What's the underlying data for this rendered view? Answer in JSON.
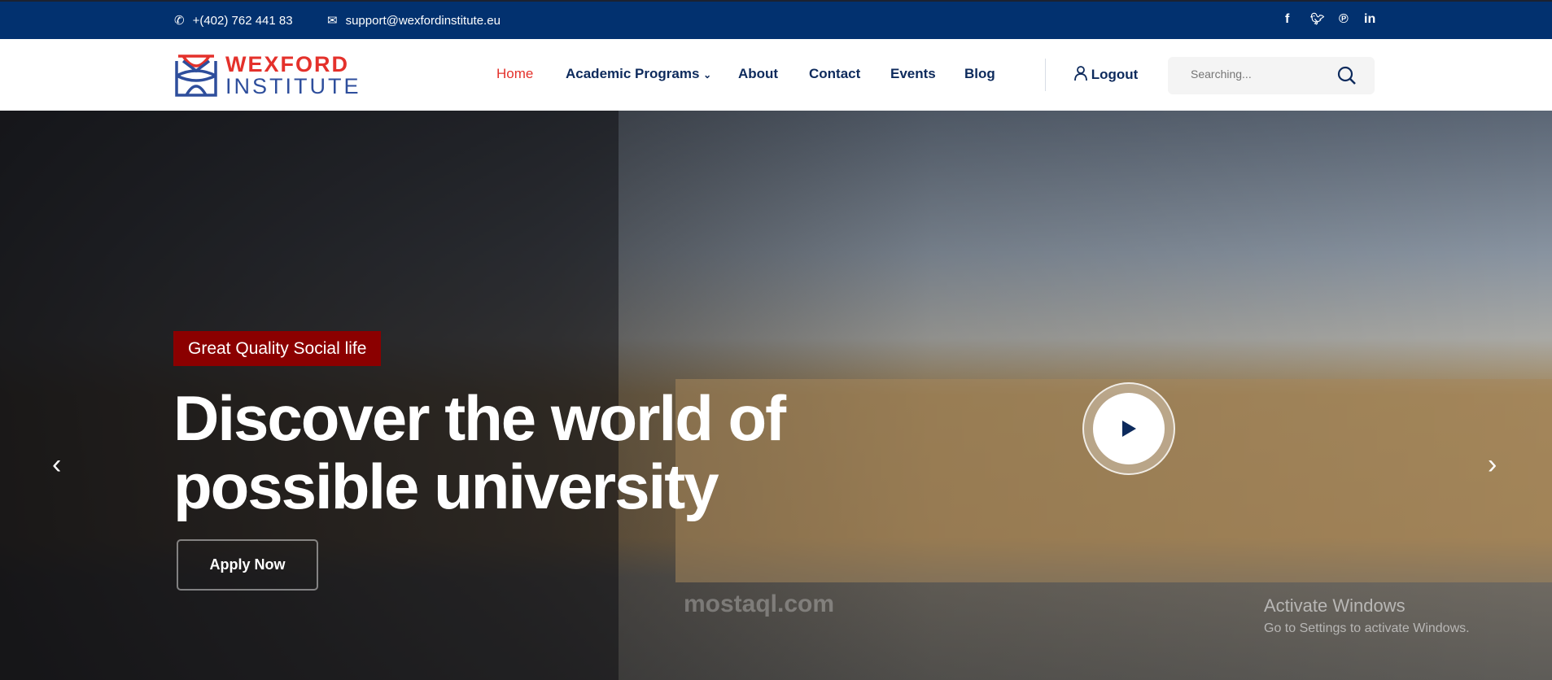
{
  "topbar": {
    "phone": "+(402) 762 441 83",
    "email": "support@wexfordinstitute.eu",
    "social": [
      "facebook-icon",
      "twitter-icon",
      "pinterest-icon",
      "linkedin-icon"
    ]
  },
  "logo": {
    "line1": "WEXFORD",
    "line2": "INSTITUTE"
  },
  "nav": {
    "items": [
      "Home",
      "Academic Programs",
      "About",
      "Contact",
      "Events",
      "Blog"
    ],
    "active": "Home",
    "logout": "Logout"
  },
  "search": {
    "placeholder": "Searching..."
  },
  "hero": {
    "badge": "Great Quality Social life",
    "headline_line1": "Discover the world of",
    "headline_line2": "possible university",
    "cta": "Apply Now"
  },
  "overlay": {
    "activate_title": "Activate Windows",
    "activate_sub": "Go to Settings to activate Windows.",
    "watermark": "mostaql.com"
  },
  "colors": {
    "topbar": "#02316f",
    "accent": "#e4312b",
    "badge": "#8b0000",
    "nav_text": "#0d2a5c"
  }
}
